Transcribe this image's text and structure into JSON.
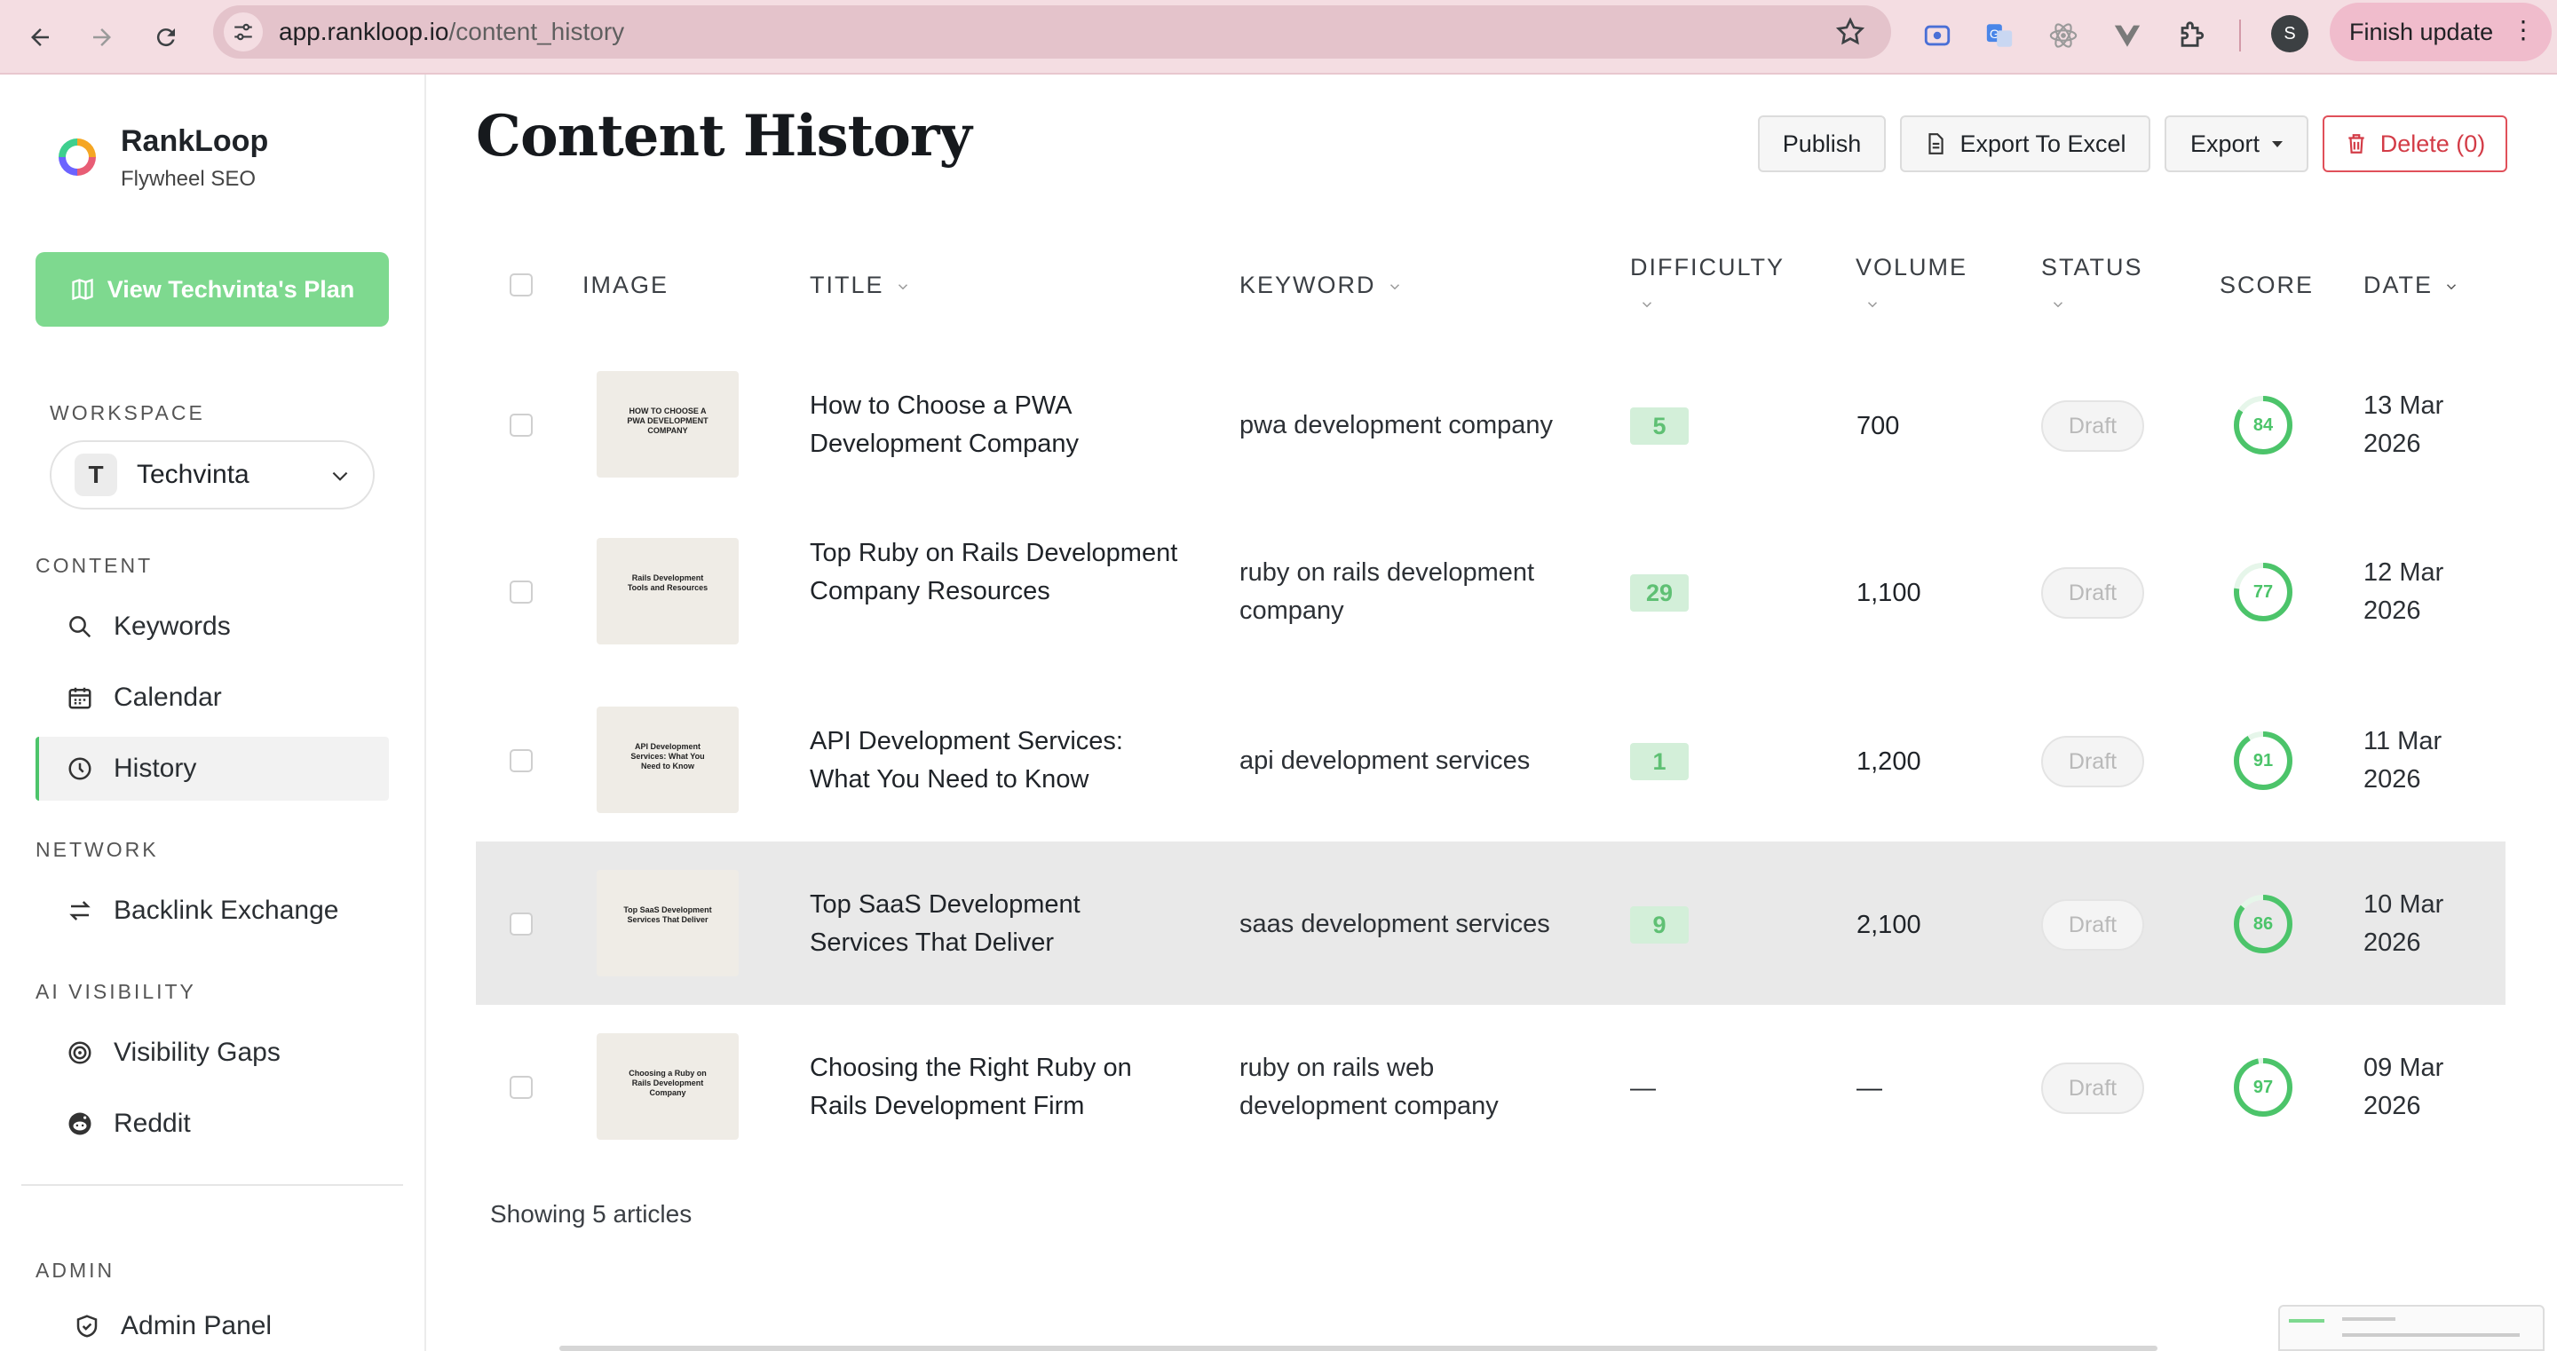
{
  "browser": {
    "url_domain": "app.rankloop.io",
    "url_path": "/content_history",
    "profile_initial": "S",
    "finish_update": "Finish update"
  },
  "sidebar": {
    "brand_name": "RankLoop",
    "brand_sub": "Flywheel SEO",
    "plan_button": "View Techvinta's Plan",
    "workspace_label": "WORKSPACE",
    "workspace_initial": "T",
    "workspace_name": "Techvinta",
    "content_label": "CONTENT",
    "network_label": "NETWORK",
    "ai_label": "AI VISIBILITY",
    "admin_label": "ADMIN",
    "items": {
      "keywords": "Keywords",
      "calendar": "Calendar",
      "history": "History",
      "backlink": "Backlink Exchange",
      "gaps": "Visibility Gaps",
      "reddit": "Reddit",
      "admin_panel": "Admin Panel"
    }
  },
  "page": {
    "title": "Content History",
    "buttons": {
      "publish": "Publish",
      "export_excel": "Export To Excel",
      "export": "Export",
      "delete": "Delete (0)"
    }
  },
  "table": {
    "headers": {
      "image": "IMAGE",
      "title": "TITLE",
      "keyword": "KEYWORD",
      "difficulty": "DIFFICULTY",
      "volume": "VOLUME",
      "status": "STATUS",
      "score": "SCORE",
      "date": "DATE"
    },
    "rows": [
      {
        "thumb_text": "HOW TO CHOOSE A PWA DEVELOPMENT COMPANY",
        "title": "How to Choose a PWA Development Company",
        "keyword": "pwa development company",
        "difficulty": "5",
        "volume": "700",
        "status": "Draft",
        "score": "84",
        "score_value": 84,
        "date": "13 Mar 2026"
      },
      {
        "thumb_text": "Rails Development Tools and Resources",
        "title": "Top Ruby on Rails Development Company Resources",
        "keyword": "ruby on rails development company",
        "difficulty": "29",
        "volume": "1,100",
        "status": "Draft",
        "score": "77",
        "score_value": 77,
        "date": "12 Mar 2026"
      },
      {
        "thumb_text": "API Development Services: What You Need to Know",
        "title": "API Development Services: What You Need to Know",
        "keyword": "api development services",
        "difficulty": "1",
        "volume": "1,200",
        "status": "Draft",
        "score": "91",
        "score_value": 91,
        "date": "11 Mar 2026"
      },
      {
        "thumb_text": "Top SaaS Development Services That Deliver",
        "title": "Top SaaS Development Services That Deliver",
        "keyword": "saas development services",
        "difficulty": "9",
        "volume": "2,100",
        "status": "Draft",
        "score": "86",
        "score_value": 86,
        "date": "10 Mar 2026"
      },
      {
        "thumb_text": "Choosing a Ruby on Rails Development Company",
        "title": "Choosing the Right Ruby on Rails Development Firm",
        "keyword": "ruby on rails web development company",
        "difficulty": "—",
        "volume": "—",
        "status": "Draft",
        "score": "97",
        "score_value": 97,
        "date": "09 Mar 2026"
      }
    ],
    "footer": "Showing 5 articles"
  },
  "colors": {
    "accent_green": "#4cc46a",
    "plan_button": "#7ed98f",
    "danger": "#d33c47",
    "chrome": "#f4dde2"
  },
  "icons": [
    "back-icon",
    "forward-icon",
    "reload-icon",
    "site-info-icon",
    "star-icon",
    "search-icon",
    "calendar-icon",
    "clock-icon",
    "exchange-icon",
    "target-icon",
    "reddit-icon",
    "shield-icon",
    "file-icon",
    "trash-icon",
    "map-icon",
    "chevron-down-icon"
  ]
}
